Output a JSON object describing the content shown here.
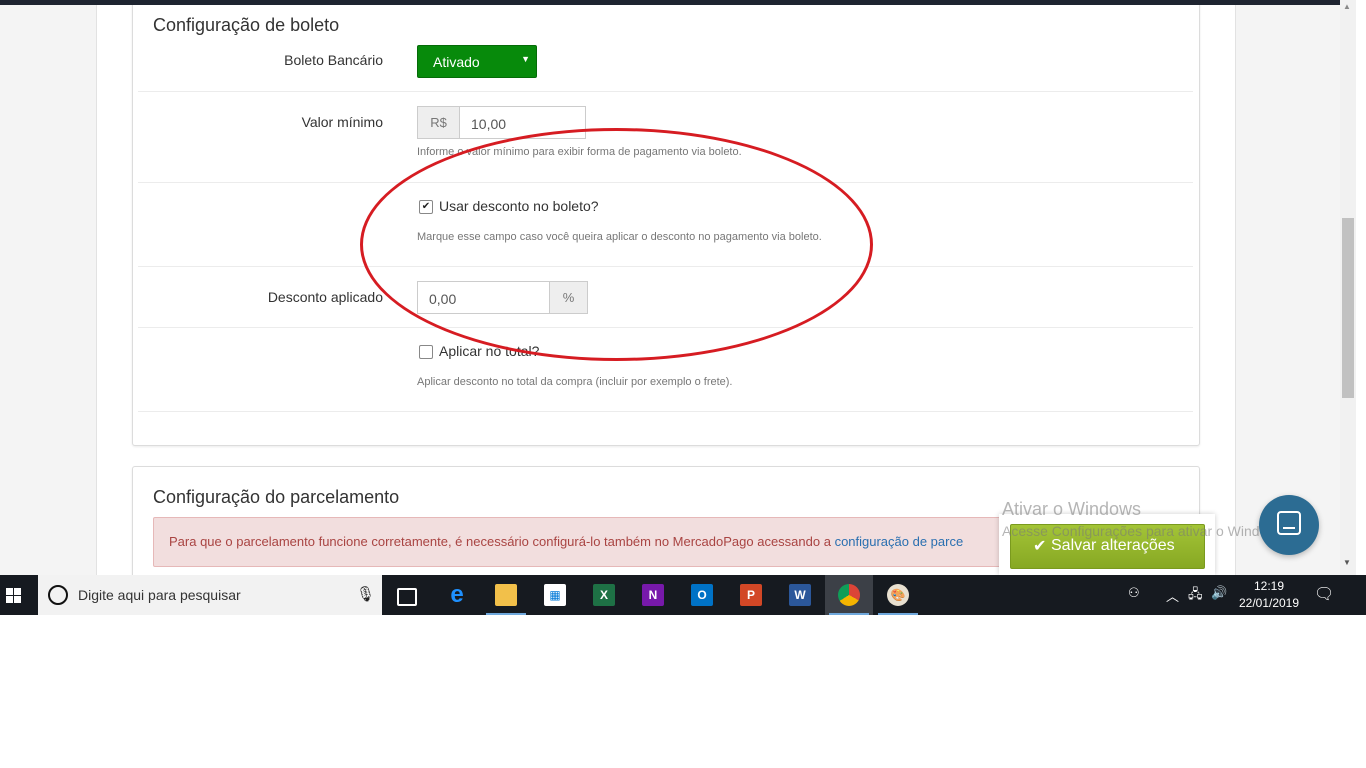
{
  "boleto_panel": {
    "title": "Configuração de boleto",
    "boleto_bancario": {
      "label": "Boleto Bancário",
      "selected": "Ativado"
    },
    "valor_minimo": {
      "label": "Valor mínimo",
      "prefix": "R$",
      "value": "10,00",
      "help": "Informe o valor mínimo para exibir forma de pagamento via boleto."
    },
    "usar_desconto": {
      "label": "Usar desconto no boleto?",
      "checked": true,
      "help": "Marque esse campo caso você queira aplicar o desconto no pagamento via boleto."
    },
    "desconto_aplicado": {
      "label": "Desconto aplicado",
      "value": "0,00",
      "suffix": "%"
    },
    "aplicar_total": {
      "label": "Aplicar no total?",
      "checked": false,
      "help": "Aplicar desconto no total da compra (incluir por exemplo o frete)."
    }
  },
  "parcelamento_panel": {
    "title": "Configuração do parcelamento",
    "alert_text": "Para que o parcelamento funcione corretamente, é necessário configurá-lo também no MercadoPago acessando a ",
    "alert_link": "configuração de parce"
  },
  "save_button": {
    "label": "Salvar alterações"
  },
  "watermark": {
    "line1": "Ativar o Windows",
    "line2": "Acesse Configurações para ativar o Windows."
  },
  "taskbar": {
    "search_placeholder": "Digite aqui para pesquisar",
    "apps": [
      "task-view",
      "edge",
      "file-explorer",
      "store",
      "excel",
      "onenote",
      "outlook",
      "powerpoint",
      "word",
      "chrome",
      "paint"
    ],
    "time": "12:19",
    "date": "22/01/2019"
  },
  "colors": {
    "select_green": "#078a0b",
    "save_green": "#97b72d",
    "alert_bg": "#f2dede",
    "annotation_red": "#d61c22",
    "chat_blue": "#2c6c93"
  }
}
